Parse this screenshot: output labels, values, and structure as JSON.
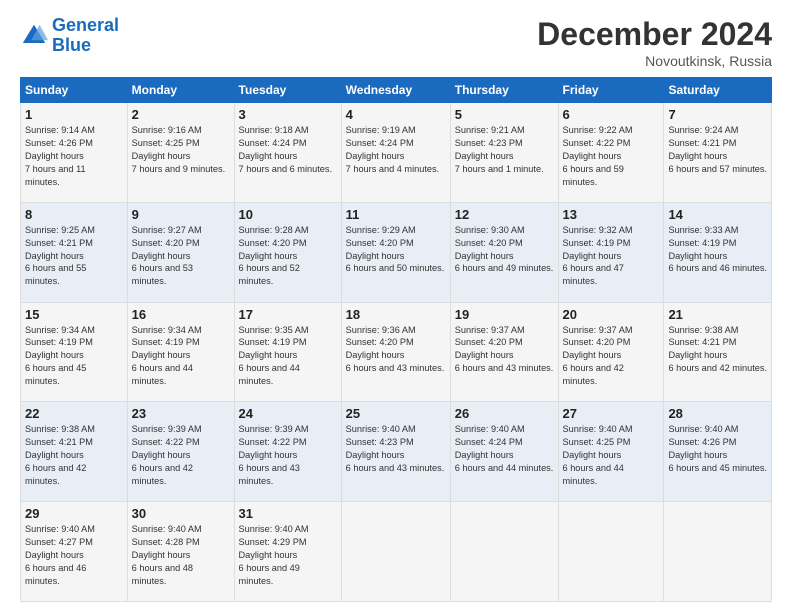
{
  "logo": {
    "line1": "General",
    "line2": "Blue"
  },
  "header": {
    "month": "December 2024",
    "location": "Novoutkinsk, Russia"
  },
  "weekdays": [
    "Sunday",
    "Monday",
    "Tuesday",
    "Wednesday",
    "Thursday",
    "Friday",
    "Saturday"
  ],
  "weeks": [
    [
      {
        "day": "1",
        "sunrise": "9:14 AM",
        "sunset": "4:26 PM",
        "daylight": "7 hours and 11 minutes."
      },
      {
        "day": "2",
        "sunrise": "9:16 AM",
        "sunset": "4:25 PM",
        "daylight": "7 hours and 9 minutes."
      },
      {
        "day": "3",
        "sunrise": "9:18 AM",
        "sunset": "4:24 PM",
        "daylight": "7 hours and 6 minutes."
      },
      {
        "day": "4",
        "sunrise": "9:19 AM",
        "sunset": "4:24 PM",
        "daylight": "7 hours and 4 minutes."
      },
      {
        "day": "5",
        "sunrise": "9:21 AM",
        "sunset": "4:23 PM",
        "daylight": "7 hours and 1 minute."
      },
      {
        "day": "6",
        "sunrise": "9:22 AM",
        "sunset": "4:22 PM",
        "daylight": "6 hours and 59 minutes."
      },
      {
        "day": "7",
        "sunrise": "9:24 AM",
        "sunset": "4:21 PM",
        "daylight": "6 hours and 57 minutes."
      }
    ],
    [
      {
        "day": "8",
        "sunrise": "9:25 AM",
        "sunset": "4:21 PM",
        "daylight": "6 hours and 55 minutes."
      },
      {
        "day": "9",
        "sunrise": "9:27 AM",
        "sunset": "4:20 PM",
        "daylight": "6 hours and 53 minutes."
      },
      {
        "day": "10",
        "sunrise": "9:28 AM",
        "sunset": "4:20 PM",
        "daylight": "6 hours and 52 minutes."
      },
      {
        "day": "11",
        "sunrise": "9:29 AM",
        "sunset": "4:20 PM",
        "daylight": "6 hours and 50 minutes."
      },
      {
        "day": "12",
        "sunrise": "9:30 AM",
        "sunset": "4:20 PM",
        "daylight": "6 hours and 49 minutes."
      },
      {
        "day": "13",
        "sunrise": "9:32 AM",
        "sunset": "4:19 PM",
        "daylight": "6 hours and 47 minutes."
      },
      {
        "day": "14",
        "sunrise": "9:33 AM",
        "sunset": "4:19 PM",
        "daylight": "6 hours and 46 minutes."
      }
    ],
    [
      {
        "day": "15",
        "sunrise": "9:34 AM",
        "sunset": "4:19 PM",
        "daylight": "6 hours and 45 minutes."
      },
      {
        "day": "16",
        "sunrise": "9:34 AM",
        "sunset": "4:19 PM",
        "daylight": "6 hours and 44 minutes."
      },
      {
        "day": "17",
        "sunrise": "9:35 AM",
        "sunset": "4:19 PM",
        "daylight": "6 hours and 44 minutes."
      },
      {
        "day": "18",
        "sunrise": "9:36 AM",
        "sunset": "4:20 PM",
        "daylight": "6 hours and 43 minutes."
      },
      {
        "day": "19",
        "sunrise": "9:37 AM",
        "sunset": "4:20 PM",
        "daylight": "6 hours and 43 minutes."
      },
      {
        "day": "20",
        "sunrise": "9:37 AM",
        "sunset": "4:20 PM",
        "daylight": "6 hours and 42 minutes."
      },
      {
        "day": "21",
        "sunrise": "9:38 AM",
        "sunset": "4:21 PM",
        "daylight": "6 hours and 42 minutes."
      }
    ],
    [
      {
        "day": "22",
        "sunrise": "9:38 AM",
        "sunset": "4:21 PM",
        "daylight": "6 hours and 42 minutes."
      },
      {
        "day": "23",
        "sunrise": "9:39 AM",
        "sunset": "4:22 PM",
        "daylight": "6 hours and 42 minutes."
      },
      {
        "day": "24",
        "sunrise": "9:39 AM",
        "sunset": "4:22 PM",
        "daylight": "6 hours and 43 minutes."
      },
      {
        "day": "25",
        "sunrise": "9:40 AM",
        "sunset": "4:23 PM",
        "daylight": "6 hours and 43 minutes."
      },
      {
        "day": "26",
        "sunrise": "9:40 AM",
        "sunset": "4:24 PM",
        "daylight": "6 hours and 44 minutes."
      },
      {
        "day": "27",
        "sunrise": "9:40 AM",
        "sunset": "4:25 PM",
        "daylight": "6 hours and 44 minutes."
      },
      {
        "day": "28",
        "sunrise": "9:40 AM",
        "sunset": "4:26 PM",
        "daylight": "6 hours and 45 minutes."
      }
    ],
    [
      {
        "day": "29",
        "sunrise": "9:40 AM",
        "sunset": "4:27 PM",
        "daylight": "6 hours and 46 minutes."
      },
      {
        "day": "30",
        "sunrise": "9:40 AM",
        "sunset": "4:28 PM",
        "daylight": "6 hours and 48 minutes."
      },
      {
        "day": "31",
        "sunrise": "9:40 AM",
        "sunset": "4:29 PM",
        "daylight": "6 hours and 49 minutes."
      },
      null,
      null,
      null,
      null
    ]
  ]
}
